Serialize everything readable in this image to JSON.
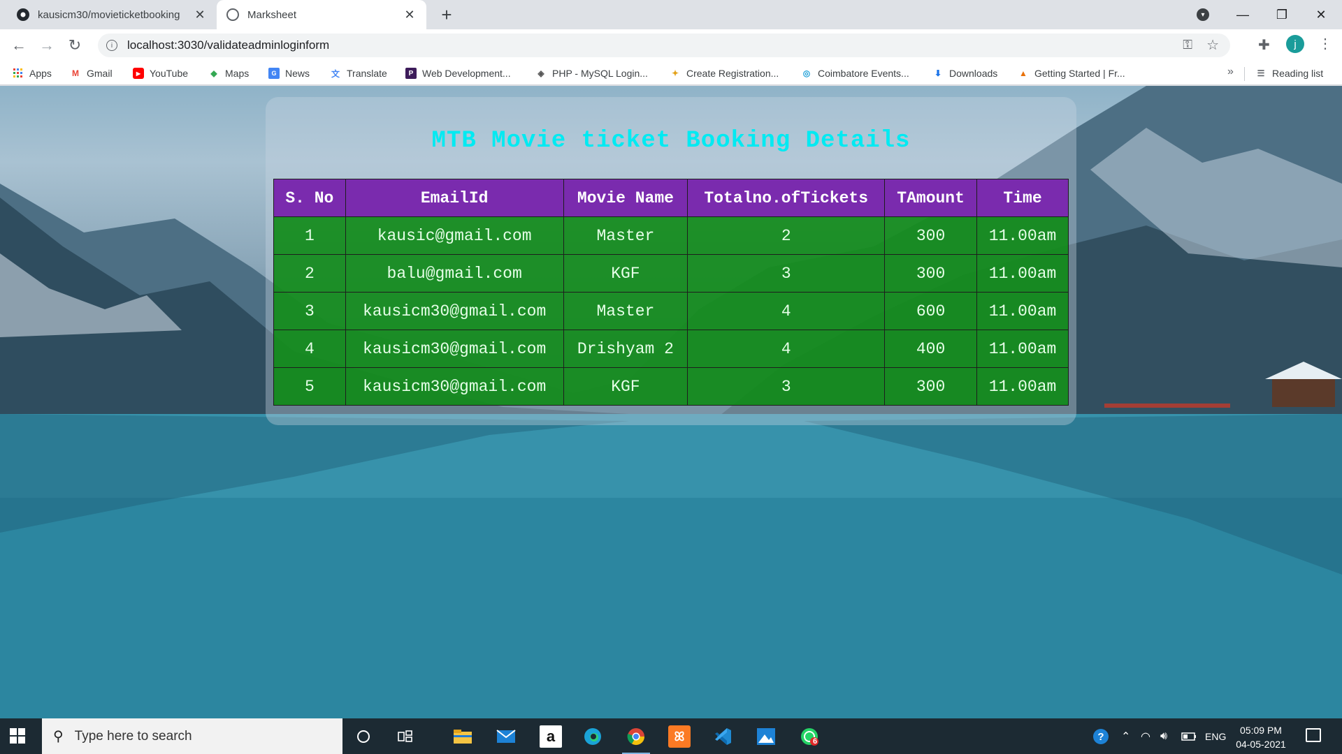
{
  "browser": {
    "tabs": [
      {
        "title": "kausicm30/movieticketbooking",
        "favicon": "github-icon",
        "active": false
      },
      {
        "title": "Marksheet",
        "favicon": "globe-icon",
        "active": true
      }
    ],
    "url": "localhost:3030/validateadminloginform",
    "profile_initial": "j"
  },
  "bookmarks": {
    "items": [
      {
        "label": "Apps",
        "icon": "apps-grid-icon"
      },
      {
        "label": "Gmail",
        "icon": "gmail-icon"
      },
      {
        "label": "YouTube",
        "icon": "youtube-icon"
      },
      {
        "label": "Maps",
        "icon": "maps-icon"
      },
      {
        "label": "News",
        "icon": "news-icon"
      },
      {
        "label": "Translate",
        "icon": "translate-icon"
      },
      {
        "label": "Web Development...",
        "icon": "web-dev-icon"
      },
      {
        "label": "PHP - MySQL Login...",
        "icon": "php-icon"
      },
      {
        "label": "Create Registration...",
        "icon": "registration-icon"
      },
      {
        "label": "Coimbatore Events...",
        "icon": "events-icon"
      },
      {
        "label": "Downloads",
        "icon": "download-icon"
      },
      {
        "label": "Getting Started | Fr...",
        "icon": "getting-started-icon"
      }
    ],
    "reading_list": "Reading list"
  },
  "page": {
    "heading": "MTB Movie ticket Booking Details",
    "table": {
      "headers": [
        "S. No",
        "EmailId",
        "Movie Name",
        "Totalno.ofTickets",
        "TAmount",
        "Time"
      ],
      "rows": [
        [
          "1",
          "kausic@gmail.com",
          "Master",
          "2",
          "300",
          "11.00am"
        ],
        [
          "2",
          "balu@gmail.com",
          "KGF",
          "3",
          "300",
          "11.00am"
        ],
        [
          "3",
          "kausicm30@gmail.com",
          "Master",
          "4",
          "600",
          "11.00am"
        ],
        [
          "4",
          "kausicm30@gmail.com",
          "Drishyam 2",
          "4",
          "400",
          "11.00am"
        ],
        [
          "5",
          "kausicm30@gmail.com",
          "KGF",
          "3",
          "300",
          "11.00am"
        ]
      ]
    },
    "colors": {
      "heading": "#00eaf2",
      "header_bg": "#7a2bae",
      "row_bg": "#0e8a16"
    }
  },
  "taskbar": {
    "search_placeholder": "Type here to search",
    "language": "ENG",
    "time": "05:09 PM",
    "date": "04-05-2021",
    "whatsapp_badge": "6"
  }
}
